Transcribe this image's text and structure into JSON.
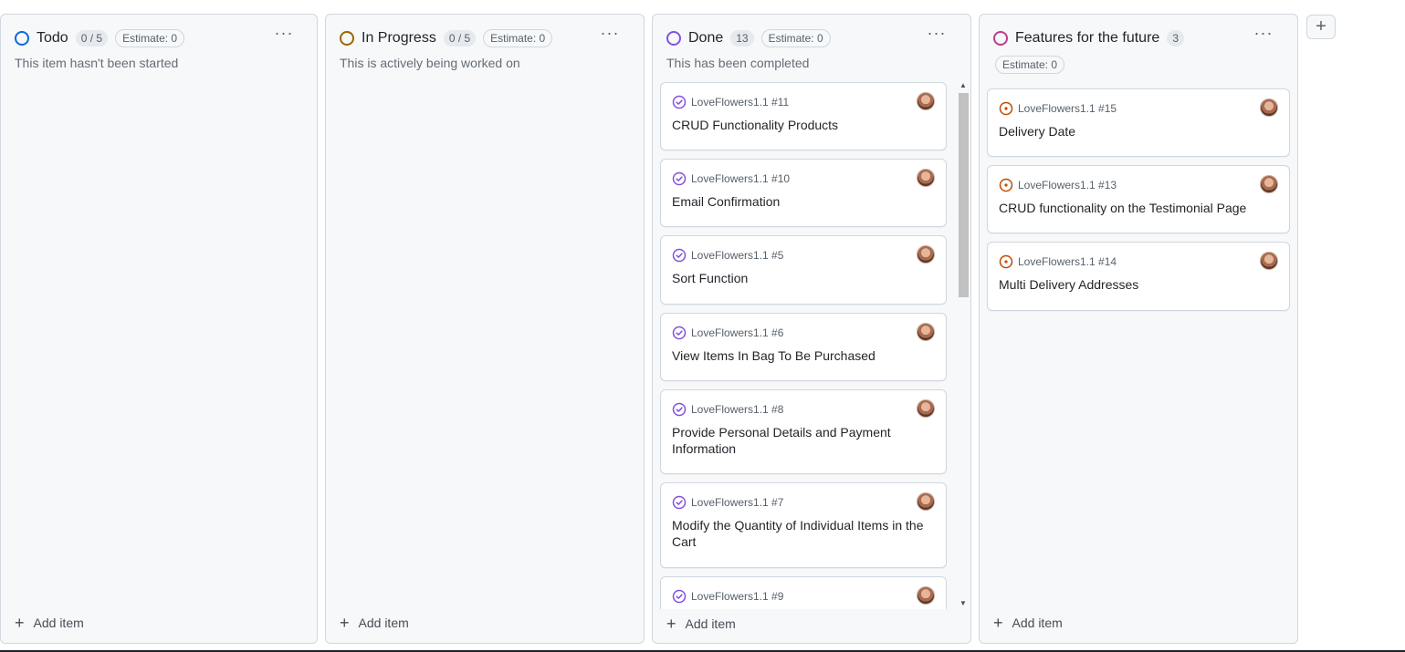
{
  "add_column_label": "+",
  "colors": {
    "todo": "#0969da",
    "in_progress": "#9a6700",
    "done": "#8250df",
    "future": "#bf3989",
    "open_issue": "#bc4c00"
  },
  "columns": [
    {
      "title": "Todo",
      "count": "0 / 5",
      "estimate": "Estimate: 0",
      "description": "This item hasn't been started",
      "add_label": "Add item",
      "more": "···"
    },
    {
      "title": "In Progress",
      "count": "0 / 5",
      "estimate": "Estimate: 0",
      "description": "This is actively being worked on",
      "add_label": "Add item",
      "more": "···"
    },
    {
      "title": "Done",
      "count": "13",
      "estimate": "Estimate: 0",
      "description": "This has been completed",
      "add_label": "Add item",
      "more": "···",
      "cards": [
        {
          "ref": "LoveFlowers1.1 #11",
          "title": "CRUD Functionality Products"
        },
        {
          "ref": "LoveFlowers1.1 #10",
          "title": "Email Confirmation"
        },
        {
          "ref": "LoveFlowers1.1 #5",
          "title": "Sort Function"
        },
        {
          "ref": "LoveFlowers1.1 #6",
          "title": "View Items In Bag To Be Purchased"
        },
        {
          "ref": "LoveFlowers1.1 #8",
          "title": "Provide Personal Details and Payment Information"
        },
        {
          "ref": "LoveFlowers1.1 #7",
          "title": "Modify the Quantity of Individual Items in the Cart"
        },
        {
          "ref": "LoveFlowers1.1 #9",
          "title": ""
        }
      ]
    },
    {
      "title": "Features for the future",
      "count": "3",
      "estimate": "Estimate: 0",
      "description": "",
      "add_label": "Add item",
      "more": "···",
      "cards": [
        {
          "ref": "LoveFlowers1.1 #15",
          "title": "Delivery Date"
        },
        {
          "ref": "LoveFlowers1.1 #13",
          "title": "CRUD functionality on the Testimonial Page"
        },
        {
          "ref": "LoveFlowers1.1 #14",
          "title": "Multi Delivery Addresses"
        }
      ]
    }
  ]
}
